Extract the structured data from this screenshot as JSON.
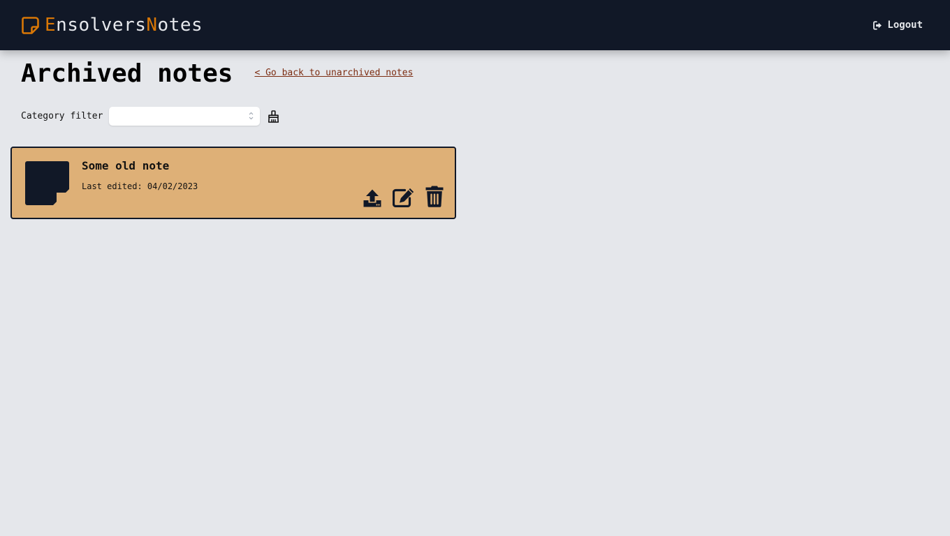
{
  "navbar": {
    "brand": {
      "e": "E",
      "nsolvers": "nsolvers",
      "n": "N",
      "otes": "otes"
    },
    "logout_label": "Logout",
    "accent_color": "#d97706",
    "background_color": "#111827"
  },
  "page": {
    "title": "Archived notes",
    "back_link": "< Go back to unarchived notes"
  },
  "filter": {
    "label": "Category filter",
    "selected_value": "",
    "clear_icon": "broom-icon"
  },
  "notes": [
    {
      "title": "Some old note",
      "last_edited_label": "Last edited: 04/02/2023",
      "card_color": "#deb077",
      "actions": [
        "unarchive-icon",
        "edit-icon",
        "trash-icon"
      ]
    }
  ]
}
